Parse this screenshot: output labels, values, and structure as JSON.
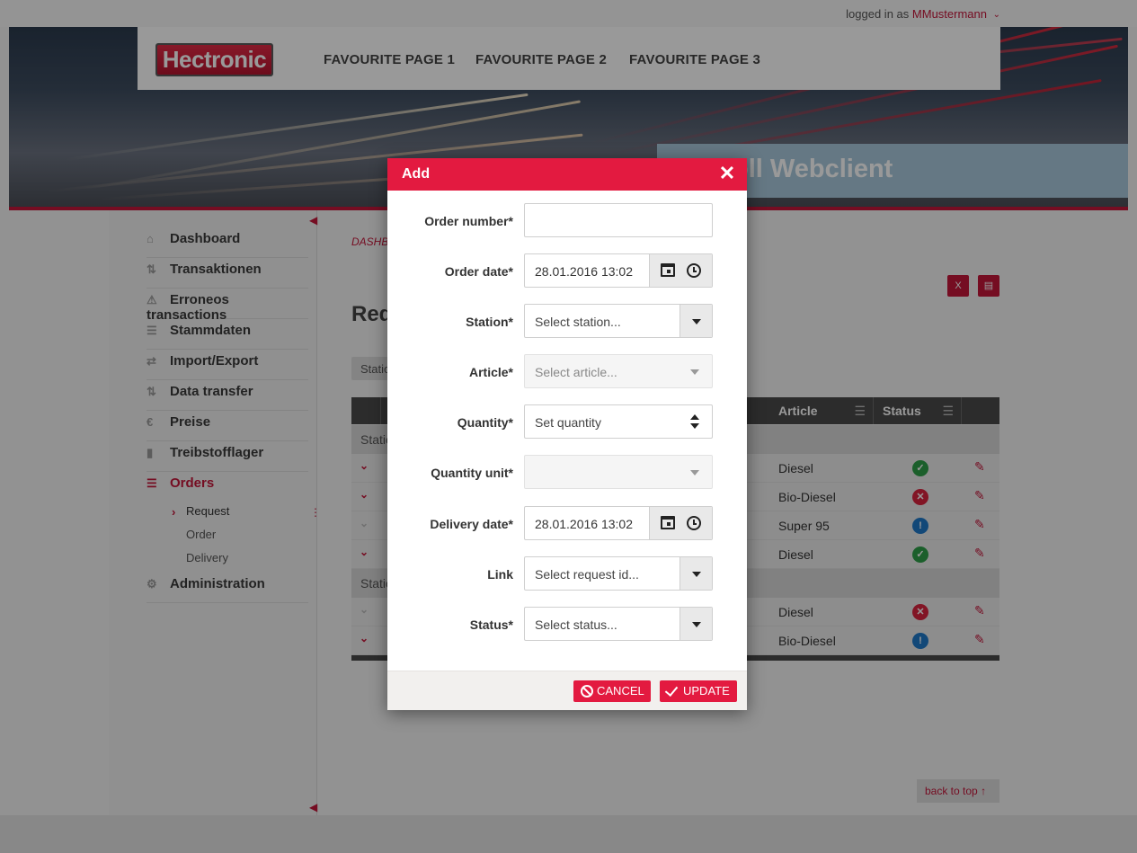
{
  "header": {
    "logged_in_prefix": "logged in as",
    "user": "MMustermann",
    "logo_text": "Hectronic",
    "favourites": [
      "FAVOURITE PAGE 1",
      "FAVOURITE PAGE 2",
      "FAVOURITE PAGE 3"
    ],
    "app_title": "oll Webclient"
  },
  "sidebar": {
    "items": [
      {
        "label": "Dashboard",
        "icon": "home-icon"
      },
      {
        "label": "Transaktionen",
        "icon": "transfer-icon"
      },
      {
        "label": "Erroneos transactions",
        "icon": "warning-icon"
      },
      {
        "label": "Stammdaten",
        "icon": "list-icon"
      },
      {
        "label": "Import/Export",
        "icon": "import-export-icon"
      },
      {
        "label": "Data transfer",
        "icon": "transfer-icon"
      },
      {
        "label": "Preise",
        "icon": "euro-icon"
      },
      {
        "label": "Treibstofflager",
        "icon": "fuel-icon"
      },
      {
        "label": "Orders",
        "icon": "list-icon"
      },
      {
        "label": "Administration",
        "icon": "gear-icon"
      }
    ],
    "sub_items": [
      "Request",
      "Order",
      "Delivery"
    ]
  },
  "main": {
    "breadcrumb": "DASHB",
    "title": "Req",
    "filter_chip": "Statio",
    "grid_headers": [
      {
        "label": "Article"
      },
      {
        "label": "Status"
      }
    ],
    "group_label": "Statio",
    "rows": [
      {
        "article": "Diesel",
        "status": "ok"
      },
      {
        "article": "Bio-Diesel",
        "status": "error"
      },
      {
        "article": "Super 95",
        "status": "info"
      },
      {
        "article": "Diesel",
        "status": "ok"
      },
      {
        "article": "Diesel",
        "status": "error"
      },
      {
        "article": "Bio-Diesel",
        "status": "info"
      }
    ],
    "back_to_top": "back to top"
  },
  "modal": {
    "title": "Add",
    "fields": {
      "order_number": {
        "label": "Order number*",
        "value": ""
      },
      "order_date": {
        "label": "Order date*",
        "value": "28.01.2016 13:02"
      },
      "station": {
        "label": "Station*",
        "placeholder": "Select station..."
      },
      "article": {
        "label": "Article*",
        "placeholder": "Select article..."
      },
      "quantity": {
        "label": "Quantity*",
        "placeholder": "Set quantity"
      },
      "quantity_unit": {
        "label": "Quantity unit*",
        "value": ""
      },
      "delivery_date": {
        "label": "Delivery date*",
        "value": "28.01.2016 13:02"
      },
      "link": {
        "label": "Link",
        "placeholder": "Select request id..."
      },
      "status": {
        "label": "Status*",
        "placeholder": "Select status..."
      }
    },
    "buttons": {
      "cancel": "CANCEL",
      "update": "UPDATE"
    }
  },
  "colors": {
    "accent": "#e31a40",
    "brand": "#c3163a"
  }
}
